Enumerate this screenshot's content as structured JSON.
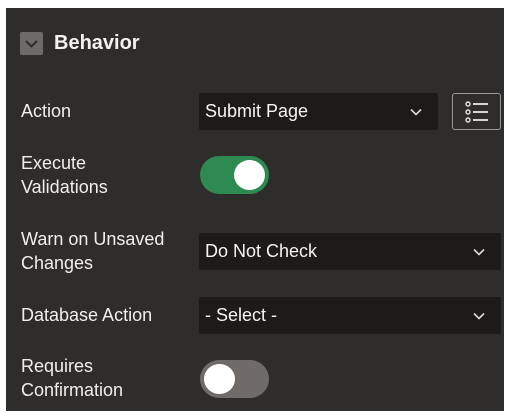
{
  "section": {
    "title": "Behavior"
  },
  "fields": {
    "action": {
      "label": "Action",
      "value": "Submit Page"
    },
    "execute_validations": {
      "label_line1": "Execute",
      "label_line2": "Validations",
      "checked": true
    },
    "warn_unsaved": {
      "label_line1": "Warn on Unsaved",
      "label_line2": "Changes",
      "value": "Do Not Check"
    },
    "database_action": {
      "label": "Database Action",
      "value": "- Select -"
    },
    "requires_confirmation": {
      "label_line1": "Requires",
      "label_line2": "Confirmation",
      "checked": false
    }
  },
  "icons": {
    "collapse": "chevron-down-icon",
    "chevron": "chevron-down-icon",
    "list": "list-icon"
  },
  "colors": {
    "panel_bg": "#2f2d2b",
    "field_bg": "#1c1b1a",
    "toggle_on": "#2f8a52",
    "toggle_off": "#6e6b68"
  }
}
